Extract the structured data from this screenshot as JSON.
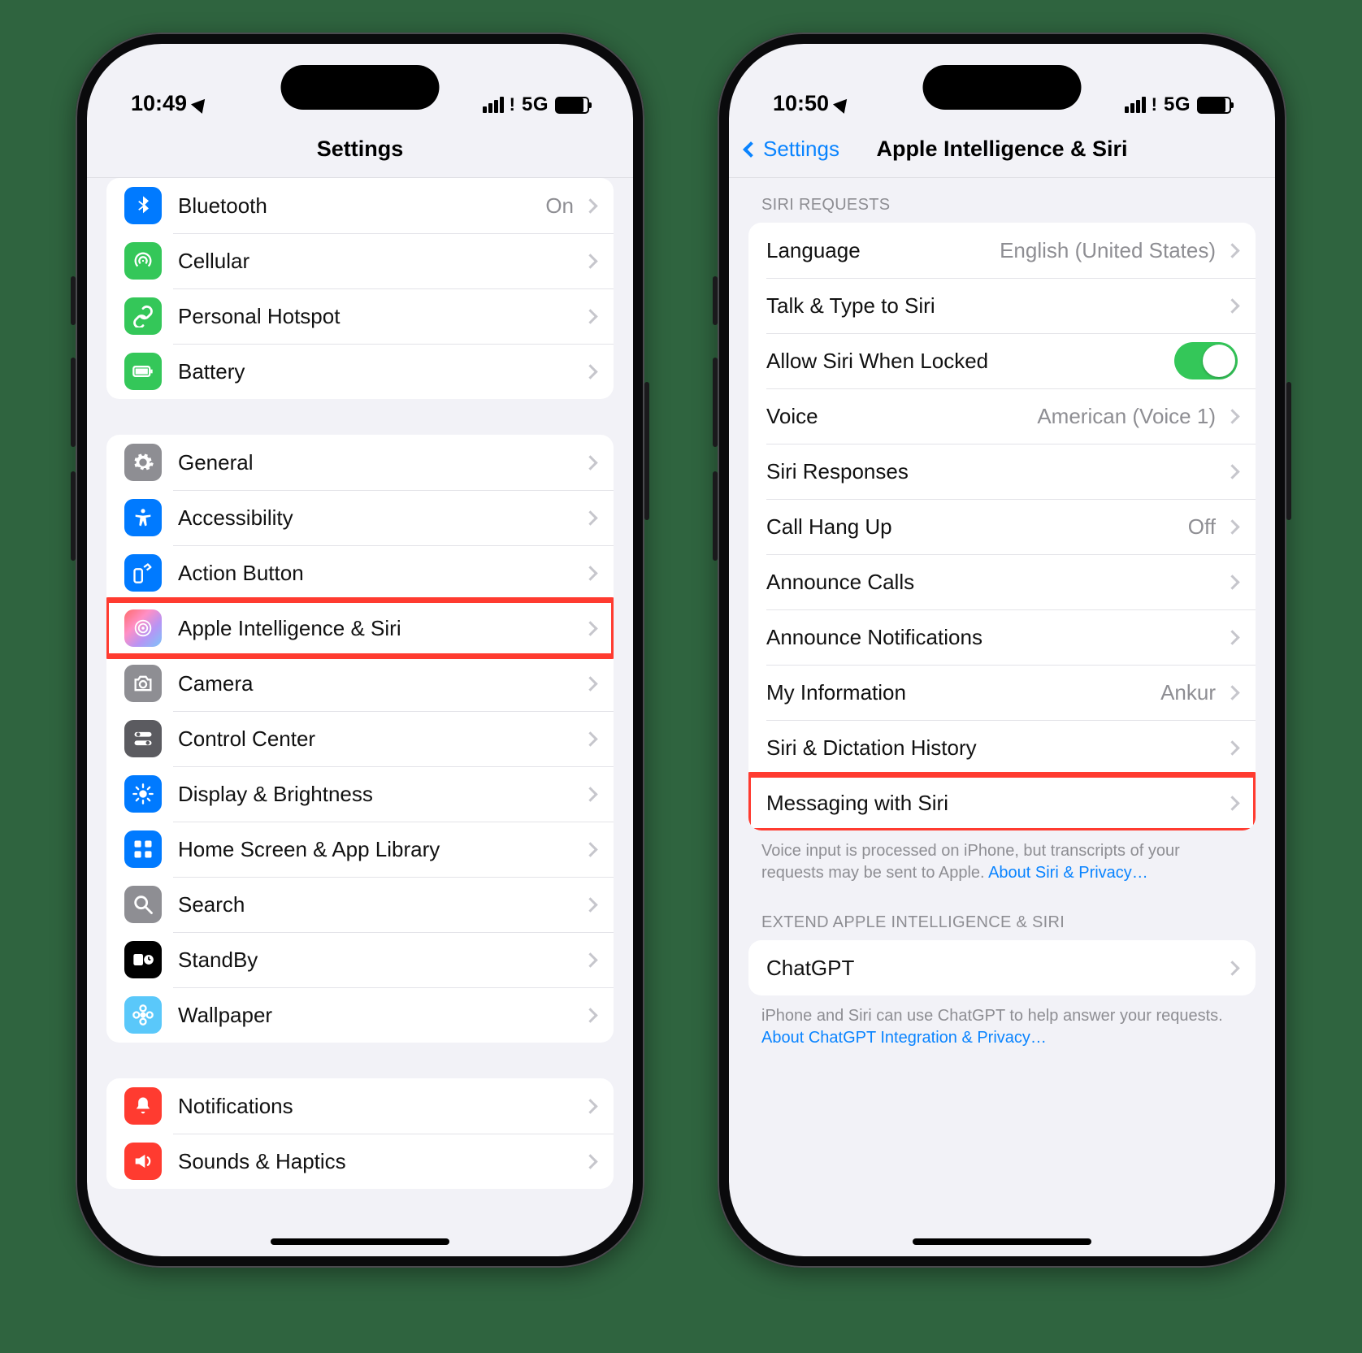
{
  "left": {
    "status": {
      "time": "10:49",
      "network": "5G"
    },
    "nav": {
      "title": "Settings"
    },
    "group1": [
      {
        "label": "Bluetooth",
        "value": "On",
        "icon": "bluetooth",
        "bg": "ic-blue"
      },
      {
        "label": "Cellular",
        "value": "",
        "icon": "antenna",
        "bg": "ic-green"
      },
      {
        "label": "Personal Hotspot",
        "value": "",
        "icon": "link",
        "bg": "ic-green"
      },
      {
        "label": "Battery",
        "value": "",
        "icon": "battery",
        "bg": "ic-green"
      }
    ],
    "group2": [
      {
        "label": "General",
        "icon": "gear",
        "bg": "ic-grey"
      },
      {
        "label": "Accessibility",
        "icon": "access",
        "bg": "ic-blue"
      },
      {
        "label": "Action Button",
        "icon": "action",
        "bg": "ic-blue"
      },
      {
        "label": "Apple Intelligence & Siri",
        "icon": "siri",
        "bg": "ic-gradient",
        "highlight": true
      },
      {
        "label": "Camera",
        "icon": "camera",
        "bg": "ic-grey"
      },
      {
        "label": "Control Center",
        "icon": "switches",
        "bg": "ic-dkgrey"
      },
      {
        "label": "Display & Brightness",
        "icon": "sun",
        "bg": "ic-blue"
      },
      {
        "label": "Home Screen & App Library",
        "icon": "grid",
        "bg": "ic-blue"
      },
      {
        "label": "Search",
        "icon": "search",
        "bg": "ic-grey"
      },
      {
        "label": "StandBy",
        "icon": "standby",
        "bg": "ic-black"
      },
      {
        "label": "Wallpaper",
        "icon": "flower",
        "bg": "ic-cyan"
      }
    ],
    "group3": [
      {
        "label": "Notifications",
        "icon": "bell",
        "bg": "ic-red"
      },
      {
        "label": "Sounds & Haptics",
        "icon": "speaker",
        "bg": "ic-red"
      }
    ]
  },
  "right": {
    "status": {
      "time": "10:50",
      "network": "5G"
    },
    "nav": {
      "back": "Settings",
      "title": "Apple Intelligence & Siri"
    },
    "section_header": "SIRI REQUESTS",
    "rows": [
      {
        "label": "Language",
        "value": "English (United States)",
        "type": "disclosure"
      },
      {
        "label": "Talk & Type to Siri",
        "value": "",
        "type": "disclosure"
      },
      {
        "label": "Allow Siri When Locked",
        "value": "on",
        "type": "toggle"
      },
      {
        "label": "Voice",
        "value": "American (Voice 1)",
        "type": "disclosure"
      },
      {
        "label": "Siri Responses",
        "value": "",
        "type": "disclosure"
      },
      {
        "label": "Call Hang Up",
        "value": "Off",
        "type": "disclosure"
      },
      {
        "label": "Announce Calls",
        "value": "",
        "type": "disclosure"
      },
      {
        "label": "Announce Notifications",
        "value": "",
        "type": "disclosure"
      },
      {
        "label": "My Information",
        "value": "Ankur",
        "type": "disclosure"
      },
      {
        "label": "Siri & Dictation History",
        "value": "",
        "type": "disclosure"
      },
      {
        "label": "Messaging with Siri",
        "value": "",
        "type": "disclosure",
        "highlight": true
      }
    ],
    "footer1_text": "Voice input is processed on iPhone, but transcripts of your requests may be sent to Apple. ",
    "footer1_link": "About Siri & Privacy…",
    "section2_header": "EXTEND APPLE INTELLIGENCE & SIRI",
    "rows2": [
      {
        "label": "ChatGPT",
        "value": "",
        "type": "disclosure"
      }
    ],
    "footer2_text": "iPhone and Siri can use ChatGPT to help answer your requests. ",
    "footer2_link": "About ChatGPT Integration & Privacy…"
  }
}
